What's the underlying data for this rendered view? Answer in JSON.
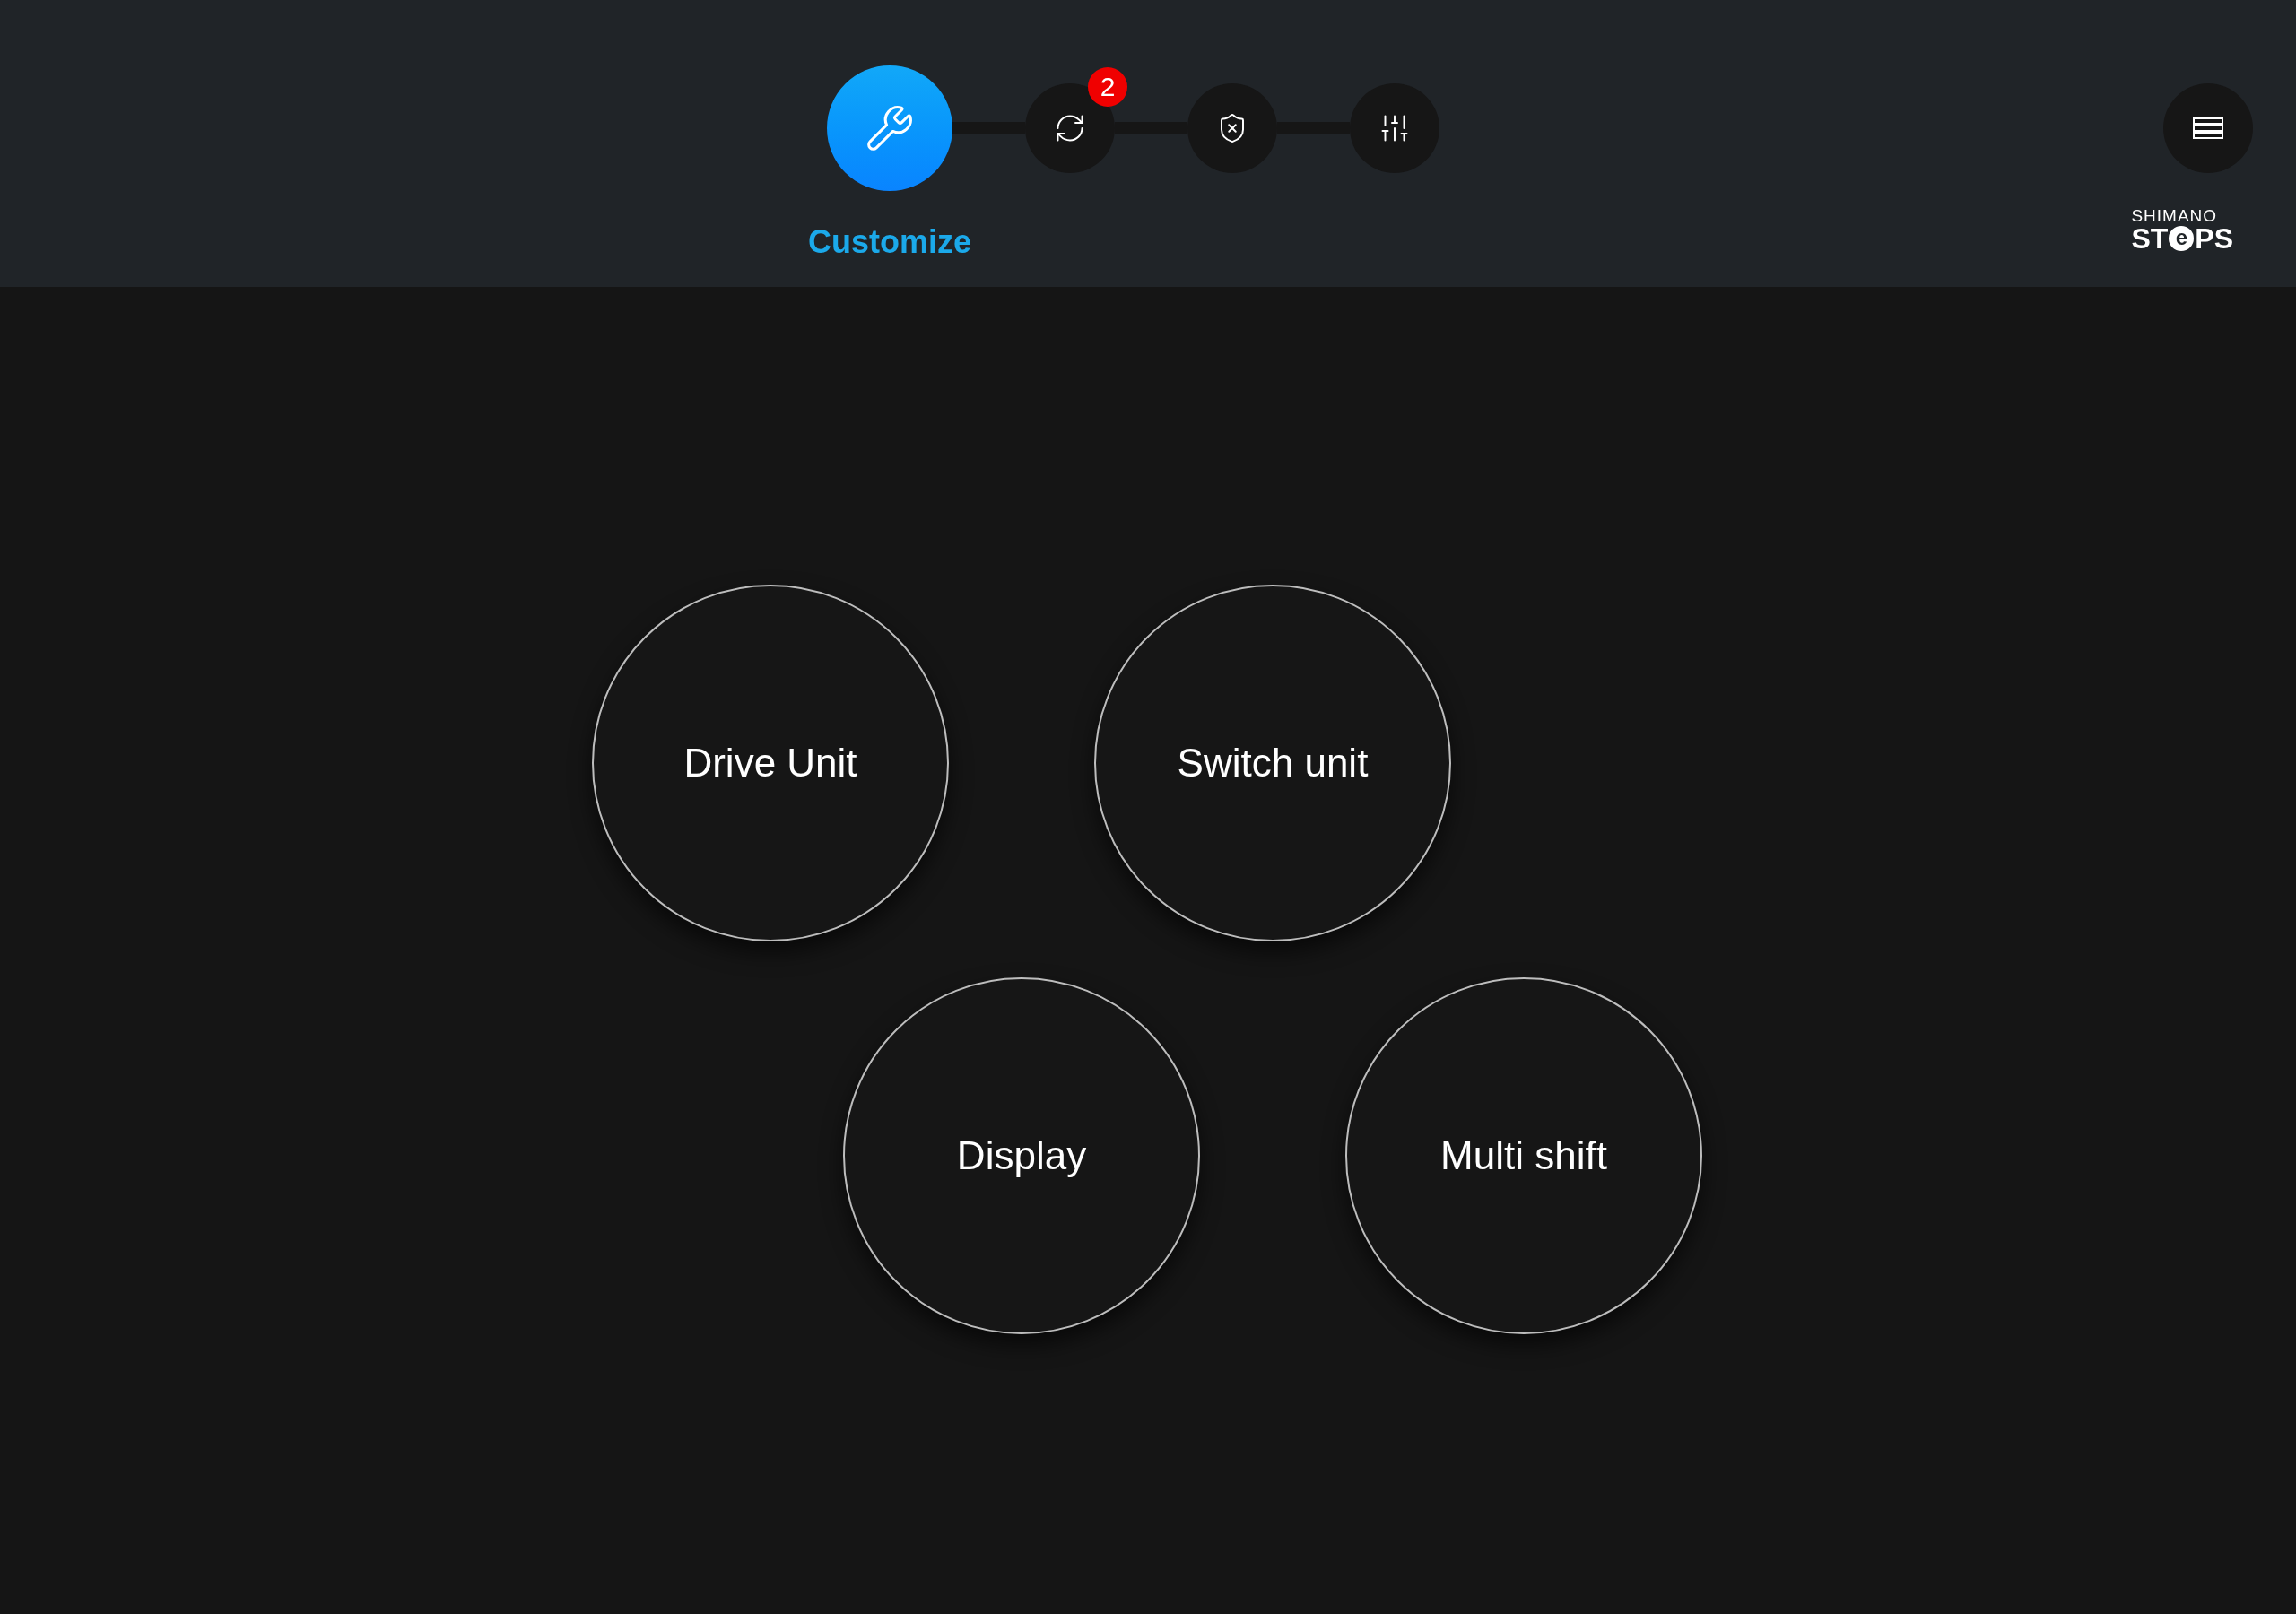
{
  "steps": [
    {
      "kind": "tools",
      "label": "Customize",
      "selected": true
    },
    {
      "kind": "sync",
      "badge": "2",
      "selected": false
    },
    {
      "kind": "shield",
      "selected": false
    },
    {
      "kind": "sliders",
      "selected": false
    }
  ],
  "logo": {
    "brand": "SHIMANO",
    "product_start": "ST",
    "product_mark": "e",
    "product_end": "PS"
  },
  "units": [
    {
      "label": "Drive Unit"
    },
    {
      "label": "Switch unit"
    },
    {
      "label": "Display"
    },
    {
      "label": "Multi shift"
    }
  ]
}
